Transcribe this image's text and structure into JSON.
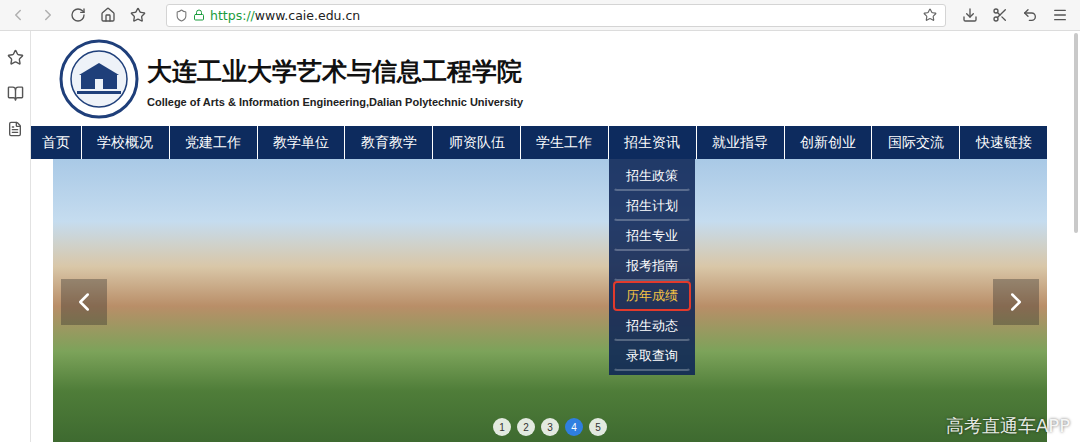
{
  "browser": {
    "url_scheme": "https://",
    "url_host": "www.caie.edu.cn"
  },
  "header": {
    "title": "大连工业大学艺术与信息工程学院",
    "subtitle": "College of Arts & Information Engineering,Dalian Polytechnic University"
  },
  "nav": {
    "items": [
      {
        "label": "首页",
        "expanded": false
      },
      {
        "label": "学校概况",
        "expanded": false
      },
      {
        "label": "党建工作",
        "expanded": false
      },
      {
        "label": "教学单位",
        "expanded": false
      },
      {
        "label": "教育教学",
        "expanded": false
      },
      {
        "label": "师资队伍",
        "expanded": false
      },
      {
        "label": "学生工作",
        "expanded": false
      },
      {
        "label": "招生资讯",
        "expanded": true
      },
      {
        "label": "就业指导",
        "expanded": false
      },
      {
        "label": "创新创业",
        "expanded": false
      },
      {
        "label": "国际交流",
        "expanded": false
      },
      {
        "label": "快速链接",
        "expanded": false
      }
    ]
  },
  "dropdown": {
    "items": [
      {
        "label": "招生政策",
        "highlighted": false
      },
      {
        "label": "招生计划",
        "highlighted": false
      },
      {
        "label": "招生专业",
        "highlighted": false
      },
      {
        "label": "报考指南",
        "highlighted": false
      },
      {
        "label": "历年成绩",
        "highlighted": true
      },
      {
        "label": "招生动态",
        "highlighted": false
      },
      {
        "label": "录取查询",
        "highlighted": false
      }
    ]
  },
  "carousel": {
    "pages": [
      {
        "label": "1",
        "selected": false
      },
      {
        "label": "2",
        "selected": false
      },
      {
        "label": "3",
        "selected": false
      },
      {
        "label": "4",
        "selected": true
      },
      {
        "label": "5",
        "selected": false
      }
    ]
  },
  "watermark": "高考直通车APP"
}
